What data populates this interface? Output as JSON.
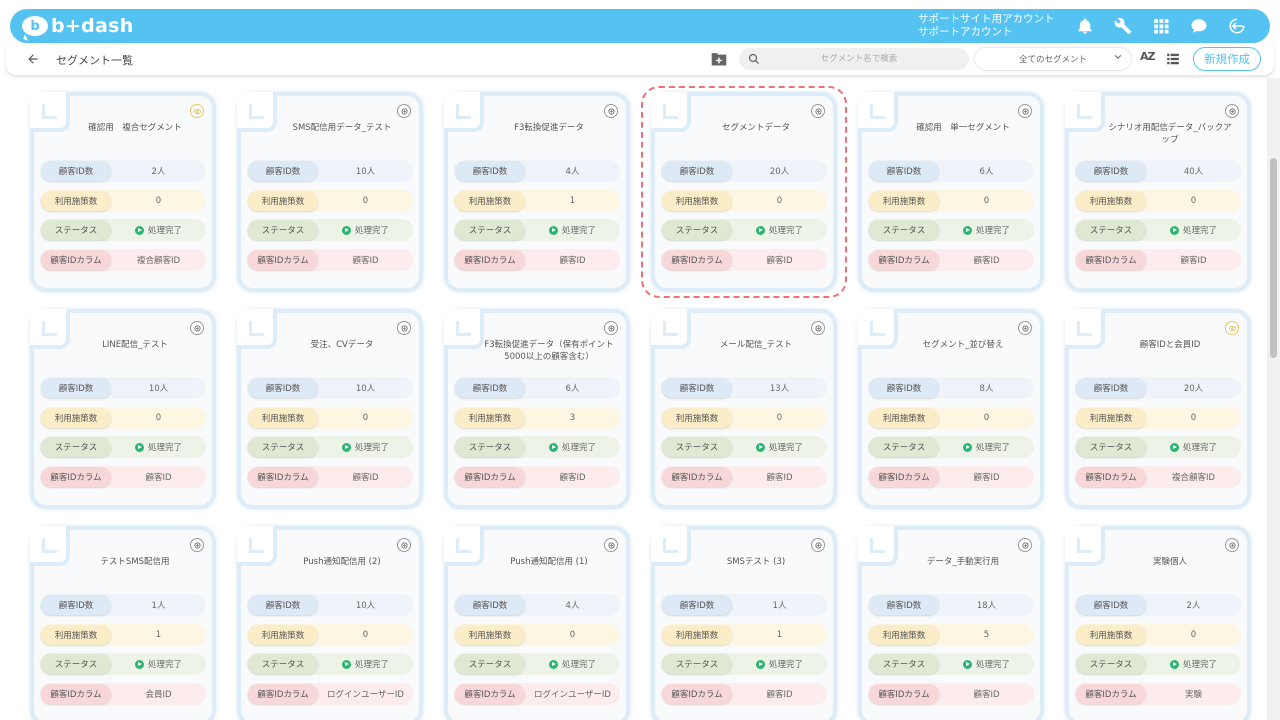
{
  "app": {
    "logo_text": "b+dash"
  },
  "account": {
    "line1": "サポートサイト用アカウント",
    "line2": "サポートアカウント"
  },
  "header": {
    "page_title": "セグメント一覧",
    "search_placeholder": "セグメント名で検索",
    "filter_selected": "全てのセグメント",
    "sort_label": "AZ",
    "new_button": "新規作成"
  },
  "icons": [
    "bell-icon",
    "wrench-icon",
    "grid-icon",
    "chat-icon",
    "logout-icon"
  ],
  "row_labels": {
    "id_count": "顧客ID数",
    "use_count": "利用施策数",
    "status": "ステータス",
    "id_column": "顧客IDカラム"
  },
  "cards": [
    {
      "title": "確認用　複合セグメント",
      "ids": "2人",
      "uses": "0",
      "status": "処理完了",
      "column": "複合顧客ID",
      "badge": "double"
    },
    {
      "title": "SMS配信用データ_テスト",
      "ids": "10人",
      "uses": "0",
      "status": "処理完了",
      "column": "顧客ID",
      "badge": "single"
    },
    {
      "title": "F3転換促進データ",
      "ids": "4人",
      "uses": "1",
      "status": "処理完了",
      "column": "顧客ID",
      "badge": "single"
    },
    {
      "title": "セグメントデータ",
      "ids": "20人",
      "uses": "0",
      "status": "処理完了",
      "column": "顧客ID",
      "badge": "single",
      "selected": true
    },
    {
      "title": "確認用　単一セグメント",
      "ids": "6人",
      "uses": "0",
      "status": "処理完了",
      "column": "顧客ID",
      "badge": "single"
    },
    {
      "title": "シナリオ用配信データ_バックアップ",
      "ids": "40人",
      "uses": "0",
      "status": "処理完了",
      "column": "顧客ID",
      "badge": "single"
    },
    {
      "title": "LINE配信_テスト",
      "ids": "10人",
      "uses": "0",
      "status": "処理完了",
      "column": "顧客ID",
      "badge": "single"
    },
    {
      "title": "受注、CVデータ",
      "ids": "10人",
      "uses": "0",
      "status": "処理完了",
      "column": "顧客ID",
      "badge": "single"
    },
    {
      "title": "F3転換促進データ（保有ポイント5000以上の顧客含む）",
      "ids": "6人",
      "uses": "3",
      "status": "処理完了",
      "column": "顧客ID",
      "badge": "single"
    },
    {
      "title": "メール配信_テスト",
      "ids": "13人",
      "uses": "0",
      "status": "処理完了",
      "column": "顧客ID",
      "badge": "single"
    },
    {
      "title": "セグメント_並び替え",
      "ids": "8人",
      "uses": "0",
      "status": "処理完了",
      "column": "顧客ID",
      "badge": "single"
    },
    {
      "title": "顧客IDと会員ID",
      "ids": "20人",
      "uses": "0",
      "status": "処理完了",
      "column": "複合顧客ID",
      "badge": "double"
    },
    {
      "title": "テストSMS配信用",
      "ids": "1人",
      "uses": "1",
      "status": "処理完了",
      "column": "会員ID",
      "badge": "single"
    },
    {
      "title": "Push通知配信用 (2)",
      "ids": "10人",
      "uses": "0",
      "status": "処理完了",
      "column": "ログインユーザーID",
      "badge": "single"
    },
    {
      "title": "Push通知配信用 (1)",
      "ids": "4人",
      "uses": "0",
      "status": "処理完了",
      "column": "ログインユーザーID",
      "badge": "single"
    },
    {
      "title": "SMSテスト (3)",
      "ids": "1人",
      "uses": "1",
      "status": "処理完了",
      "column": "顧客ID",
      "badge": "single"
    },
    {
      "title": "データ_手動実行用",
      "ids": "18人",
      "uses": "5",
      "status": "処理完了",
      "column": "顧客ID",
      "badge": "single"
    },
    {
      "title": "実験個人",
      "ids": "2人",
      "uses": "0",
      "status": "処理完了",
      "column": "実験",
      "badge": "single"
    }
  ]
}
